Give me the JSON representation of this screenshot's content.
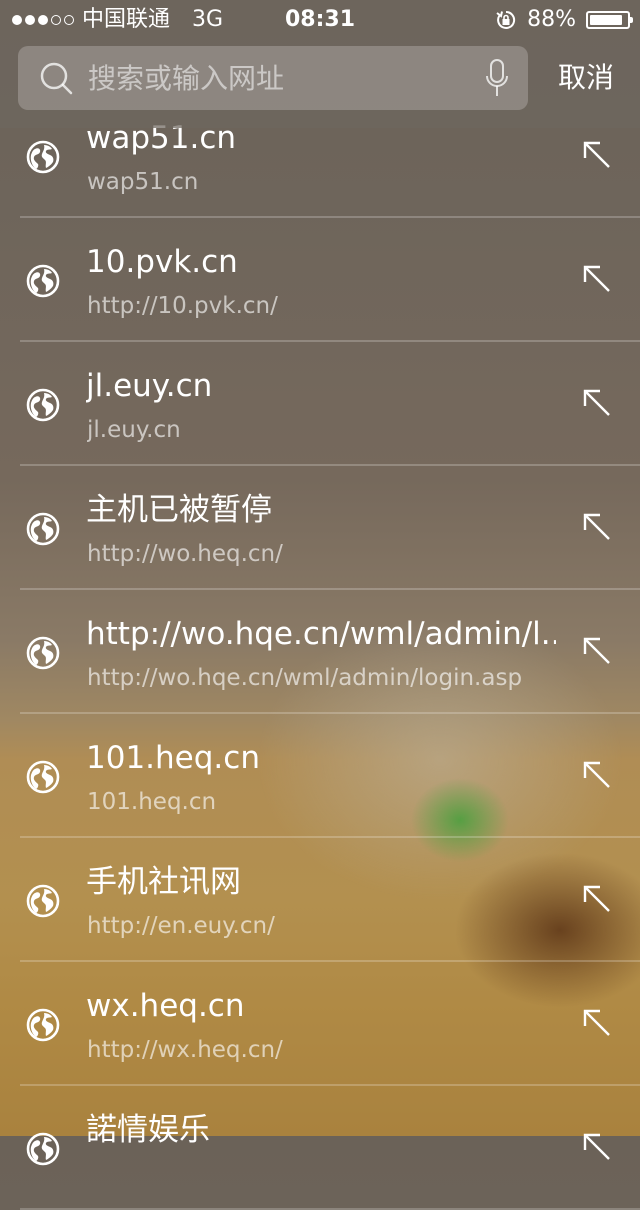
{
  "status": {
    "carrier": "中国联通",
    "network": "3G",
    "time": "08:31",
    "battery_percent": "88%",
    "battery_level": 0.88,
    "signal_bars": [
      true,
      true,
      true,
      false,
      false
    ]
  },
  "search": {
    "placeholder": "搜索或输入网址",
    "value": "",
    "cancel_label": "取消"
  },
  "results": [
    {
      "title": "wap51.cn",
      "url": "wap51.cn"
    },
    {
      "title": "10.pvk.cn",
      "url": "http://10.pvk.cn/"
    },
    {
      "title": "jl.euy.cn",
      "url": "jl.euy.cn"
    },
    {
      "title": "主机已被暂停",
      "url": "http://wo.heq.cn/"
    },
    {
      "title": "http://wo.hqe.cn/wml/admin/l...",
      "url": "http://wo.hqe.cn/wml/admin/login.asp"
    },
    {
      "title": "101.heq.cn",
      "url": "101.heq.cn"
    },
    {
      "title": "手机社讯网",
      "url": "http://en.euy.cn/"
    },
    {
      "title": "wx.heq.cn",
      "url": "http://wx.heq.cn/"
    },
    {
      "title": "諾情娱乐",
      "url": ""
    }
  ],
  "icons": {
    "row_icon": "globe-icon",
    "row_action": "fill-arrow-icon",
    "search": "search-icon",
    "mic": "microphone-icon",
    "orientation_lock": "orientation-lock-icon"
  },
  "colors": {
    "text": "#ffffff",
    "secondary_text": "rgba(255,255,255,0.62)"
  }
}
